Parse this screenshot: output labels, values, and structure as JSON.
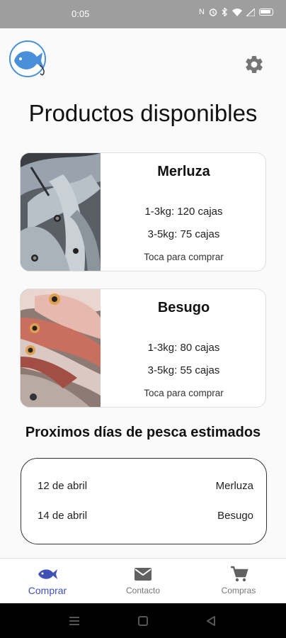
{
  "status_bar": {
    "time": "0:05",
    "icons": [
      "nfc-icon",
      "alarm-icon",
      "bluetooth-icon",
      "wifi-icon",
      "signal-icon",
      "battery-icon"
    ]
  },
  "header": {
    "logo_icon": "fish-logo-icon",
    "settings_icon": "gear-icon"
  },
  "page_title": "Productos disponibles",
  "products": [
    {
      "name": "Merluza",
      "stock_1": "1-3kg: 120 cajas",
      "stock_2": "3-5kg: 75 cajas",
      "hint": "Toca para comprar"
    },
    {
      "name": "Besugo",
      "stock_1": "1-3kg: 80 cajas",
      "stock_2": "3-5kg: 55 cajas",
      "hint": "Toca para comprar"
    }
  ],
  "schedule": {
    "title": "Proximos días de pesca estimados",
    "rows": [
      {
        "date": "12 de abril",
        "fish": "Merluza"
      },
      {
        "date": "14 de abril",
        "fish": "Besugo"
      }
    ]
  },
  "bottom_nav": [
    {
      "label": "Comprar",
      "icon": "fish-icon",
      "active": true
    },
    {
      "label": "Contacto",
      "icon": "mail-icon",
      "active": false
    },
    {
      "label": "Compras",
      "icon": "cart-icon",
      "active": false
    }
  ],
  "colors": {
    "accent": "#3f51b5",
    "status_bar": "#9e9e9e",
    "logo_blue": "#4a90d9",
    "nav_inactive": "#777777"
  }
}
